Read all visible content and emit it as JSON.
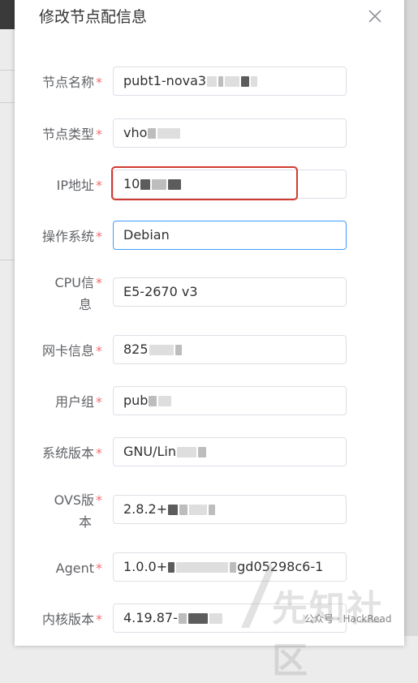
{
  "dialog": {
    "title": "修改节点配信息",
    "close_icon": "close-icon"
  },
  "fields": {
    "node_name": {
      "label": "节点名称",
      "value": "pubt1-nova3"
    },
    "node_type": {
      "label": "节点类型",
      "value": "vho"
    },
    "ip": {
      "label": "IP地址",
      "value": "10"
    },
    "os": {
      "label": "操作系统",
      "value": "Debian"
    },
    "cpu": {
      "label_line1": "CPU信",
      "label_line2": "息",
      "value": "E5-2670 v3"
    },
    "nic": {
      "label": "网卡信息",
      "value": "825"
    },
    "user_group": {
      "label": "用户组",
      "value": "pub"
    },
    "sys_version": {
      "label": "系统版本",
      "value": "GNU/Lin"
    },
    "ovs_version": {
      "label_line1": "OVS版",
      "label_line2": "本",
      "value": "2.8.2+"
    },
    "agent": {
      "label": "Agent",
      "value_prefix": "1.0.0+",
      "value_suffix": "gd05298c6-1"
    },
    "kernel": {
      "label": "内核版本",
      "value": "4.19.87-"
    }
  },
  "required_mark": "*",
  "watermark": {
    "big_text": "先知社区",
    "small_text": "公众号 · HackRead"
  },
  "colors": {
    "required": "#f56c6c",
    "focus_border": "#409eff",
    "highlight": "#d23b2f"
  }
}
